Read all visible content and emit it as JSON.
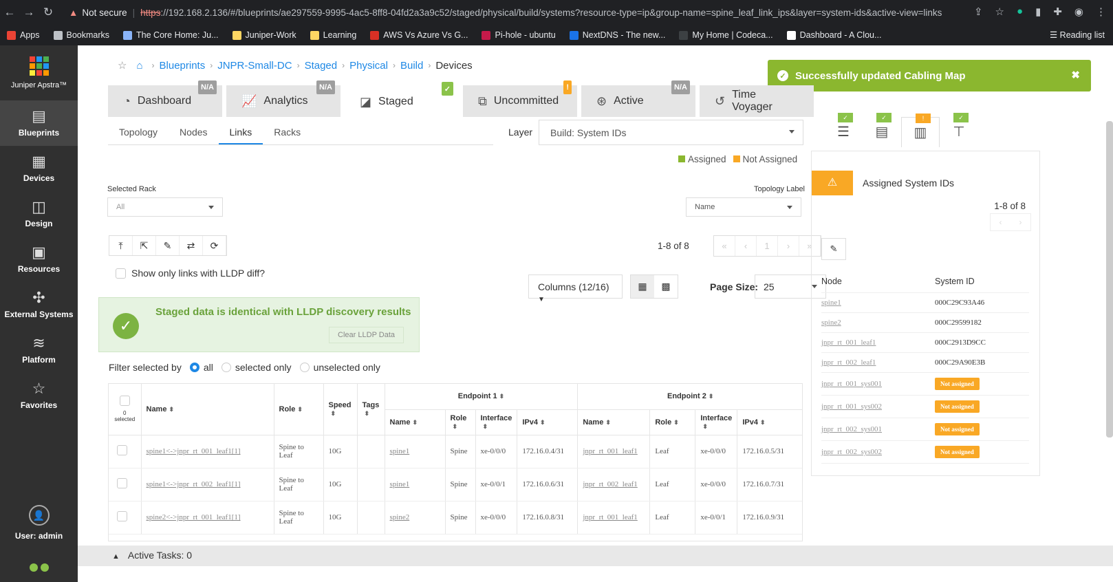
{
  "browser": {
    "security_text": "Not secure",
    "url_scheme": "https",
    "url_rest": "://192.168.2.136/#/blueprints/ae297559-9995-4ac5-8ff8-04fd2a3a9c52/staged/physical/build/systems?resource-type=ip&group-name=spine_leaf_link_ips&layer=system-ids&active-view=links",
    "bookmarks": [
      "Apps",
      "Bookmarks",
      "The Core Home: Ju...",
      "Juniper-Work",
      "Learning",
      "AWS Vs Azure Vs G...",
      "Pi-hole - ubuntu",
      "NextDNS - The new...",
      "My Home | Codeca...",
      "Dashboard - A Clou..."
    ],
    "reading_list": "Reading list"
  },
  "sidebar": {
    "app_name": "Juniper Apstra™",
    "items": [
      {
        "label": "Blueprints",
        "icon": "blueprints-icon"
      },
      {
        "label": "Devices",
        "icon": "devices-icon"
      },
      {
        "label": "Design",
        "icon": "design-icon"
      },
      {
        "label": "Resources",
        "icon": "resources-icon"
      },
      {
        "label": "External Systems",
        "icon": "external-systems-icon"
      },
      {
        "label": "Platform",
        "icon": "platform-icon"
      },
      {
        "label": "Favorites",
        "icon": "star-icon"
      }
    ],
    "user": "User: admin"
  },
  "breadcrumb": [
    "Blueprints",
    "JNPR-Small-DC",
    "Staged",
    "Physical",
    "Build",
    "Devices"
  ],
  "toast": {
    "message": "Successfully updated Cabling Map"
  },
  "tabs": [
    {
      "label": "Dashboard",
      "badge": "N/A"
    },
    {
      "label": "Analytics",
      "badge": "N/A"
    },
    {
      "label": "Staged",
      "badge": "✓"
    },
    {
      "label": "Uncommitted",
      "badge": "!"
    },
    {
      "label": "Active",
      "badge": "N/A"
    },
    {
      "label": "Time Voyager",
      "badge": ""
    }
  ],
  "subtabs": [
    "Topology",
    "Nodes",
    "Links",
    "Racks"
  ],
  "layer": {
    "label": "Layer",
    "value": "Build: System IDs"
  },
  "legend": {
    "assigned": "Assigned",
    "not_assigned": "Not Assigned",
    "assigned_color": "#8bb72f",
    "not_assigned_color": "#f9a825"
  },
  "selected_rack": {
    "label": "Selected Rack",
    "value": "All"
  },
  "topology_label": {
    "label": "Topology Label",
    "value": "Name"
  },
  "pagination": {
    "text": "1-8 of 8",
    "page": "1"
  },
  "lldp_checkbox": "Show only links with LLDP diff?",
  "columns_btn": "Columns (12/16)",
  "page_size": {
    "label": "Page Size:",
    "value": "25"
  },
  "lldp_banner": {
    "message": "Staged data is identical with LLDP discovery results",
    "clear": "Clear LLDP Data"
  },
  "filter": {
    "label": "Filter selected by",
    "options": [
      "all",
      "selected only",
      "unselected only"
    ]
  },
  "table": {
    "selected": "0 selected",
    "headers": {
      "name": "Name",
      "role": "Role",
      "speed": "Speed",
      "tags": "Tags",
      "endpoint1": "Endpoint 1",
      "endpoint2": "Endpoint 2",
      "ep_name": "Name",
      "ep_role": "Role",
      "ep_interface": "Interface",
      "ep_ipv4": "IPv4"
    },
    "rows": [
      {
        "name": "spine1<->jnpr_rt_001_leaf1[1]",
        "role": "Spine to Leaf",
        "speed": "10G",
        "tags": "",
        "e1_name": "spine1",
        "e1_role": "Spine",
        "e1_if": "xe-0/0/0",
        "e1_ip": "172.16.0.4/31",
        "e2_name": "jnpr_rt_001_leaf1",
        "e2_role": "Leaf",
        "e2_if": "xe-0/0/0",
        "e2_ip": "172.16.0.5/31"
      },
      {
        "name": "spine1<->jnpr_rt_002_leaf1[1]",
        "role": "Spine to Leaf",
        "speed": "10G",
        "tags": "",
        "e1_name": "spine1",
        "e1_role": "Spine",
        "e1_if": "xe-0/0/1",
        "e1_ip": "172.16.0.6/31",
        "e2_name": "jnpr_rt_002_leaf1",
        "e2_role": "Leaf",
        "e2_if": "xe-0/0/0",
        "e2_ip": "172.16.0.7/31"
      },
      {
        "name": "spine2<->jnpr_rt_001_leaf1[1]",
        "role": "Spine to Leaf",
        "speed": "10G",
        "tags": "",
        "e1_name": "spine2",
        "e1_role": "Spine",
        "e1_if": "xe-0/0/0",
        "e1_ip": "172.16.0.8/31",
        "e2_name": "jnpr_rt_001_leaf1",
        "e2_role": "Leaf",
        "e2_if": "xe-0/0/1",
        "e2_ip": "172.16.0.9/31"
      }
    ]
  },
  "active_tasks": "Active Tasks: 0",
  "right_panel": {
    "title": "Assigned System IDs",
    "count": "1-8 of 8",
    "headers": {
      "node": "Node",
      "system_id": "System ID"
    },
    "rows": [
      {
        "node": "spine1",
        "system_id": "000C29C93A46"
      },
      {
        "node": "spine2",
        "system_id": "000C29599182"
      },
      {
        "node": "jnpr_rt_001_leaf1",
        "system_id": "000C2913D9CC"
      },
      {
        "node": "jnpr_rt_002_leaf1",
        "system_id": "000C29A90E3B"
      },
      {
        "node": "jnpr_rt_001_sys001",
        "system_id": "Not assigned"
      },
      {
        "node": "jnpr_rt_001_sys002",
        "system_id": "Not assigned"
      },
      {
        "node": "jnpr_rt_002_sys001",
        "system_id": "Not assigned"
      },
      {
        "node": "jnpr_rt_002_sys002",
        "system_id": "Not assigned"
      }
    ]
  }
}
